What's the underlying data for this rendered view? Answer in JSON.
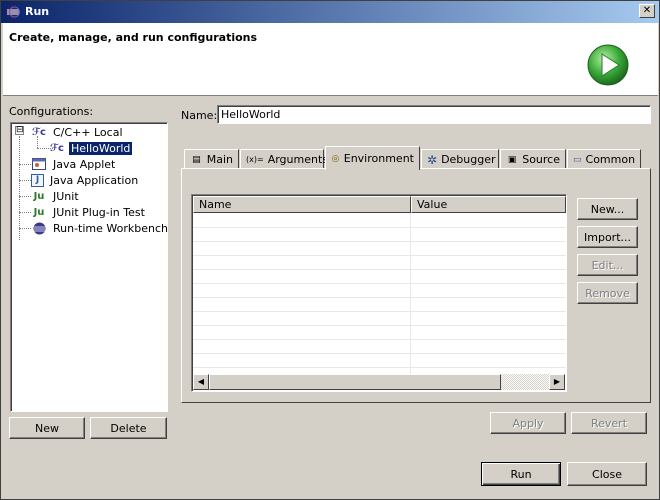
{
  "window": {
    "title": "Run",
    "close_glyph": "✕"
  },
  "banner": {
    "heading": "Create, manage, and run configurations",
    "icon": "run-play-icon",
    "accent": "#2e9a2e"
  },
  "configurations": {
    "label": "Configurations:",
    "items": [
      {
        "label": "C/C++ Local",
        "icon": "cpp-local-icon",
        "icon_text": "ℱc",
        "expander": "⊟"
      },
      {
        "label": "HelloWorld",
        "icon": "cpp-config-icon",
        "icon_text": "ℱc",
        "selected": true
      },
      {
        "label": "Java Applet",
        "icon": "java-applet-icon"
      },
      {
        "label": "Java Application",
        "icon": "java-application-icon",
        "icon_text": "J"
      },
      {
        "label": "JUnit",
        "icon": "junit-icon",
        "icon_text": "Ju"
      },
      {
        "label": "JUnit Plug-in Test",
        "icon": "junit-plugin-icon",
        "icon_text": "Ju"
      },
      {
        "label": "Run-time Workbench",
        "icon": "workbench-icon"
      }
    ],
    "new_label": "New",
    "delete_label": "Delete"
  },
  "name": {
    "label": "Name:",
    "value": "HelloWorld"
  },
  "tabs": [
    {
      "label": "Main",
      "icon": "main-tab-icon",
      "icon_text": "▤"
    },
    {
      "label": "Arguments",
      "icon": "arguments-icon",
      "icon_text": "(x)="
    },
    {
      "label": "Environment",
      "icon": "environment-icon",
      "icon_text": "◎",
      "active": true
    },
    {
      "label": "Debugger",
      "icon": "debugger-icon",
      "icon_text": "✲"
    },
    {
      "label": "Source",
      "icon": "source-icon",
      "icon_text": "▣"
    },
    {
      "label": "Common",
      "icon": "common-icon",
      "icon_text": "▭"
    }
  ],
  "env_table": {
    "columns": [
      "Name",
      "Value"
    ],
    "rows": []
  },
  "env_buttons": {
    "new": "New...",
    "import": "Import...",
    "edit": "Edit...",
    "remove": "Remove"
  },
  "footer": {
    "apply": "Apply",
    "revert": "Revert",
    "run": "Run",
    "close": "Close"
  }
}
